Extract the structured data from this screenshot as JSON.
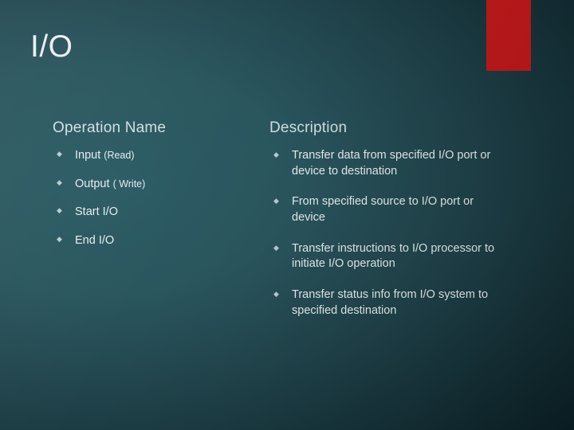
{
  "slide": {
    "title": "I/O",
    "accent_color": "#c0191b",
    "background_color": "#1e4149"
  },
  "columns": {
    "left": {
      "heading": "Operation Name",
      "bullet_glyph": "◆",
      "items": [
        {
          "main": "Input ",
          "sub": "(Read)"
        },
        {
          "main": "Output ",
          "sub": "( Write)"
        },
        {
          "main": "Start I/O",
          "sub": ""
        },
        {
          "main": "End I/O",
          "sub": ""
        }
      ]
    },
    "right": {
      "heading": "Description",
      "bullet_glyph": "◆",
      "items": [
        "Transfer data from specified I/O port or device to destination",
        "From specified source to I/O port or device",
        "Transfer instructions to I/O processor to initiate I/O operation",
        "Transfer status info from I/O system to specified destination"
      ]
    }
  }
}
